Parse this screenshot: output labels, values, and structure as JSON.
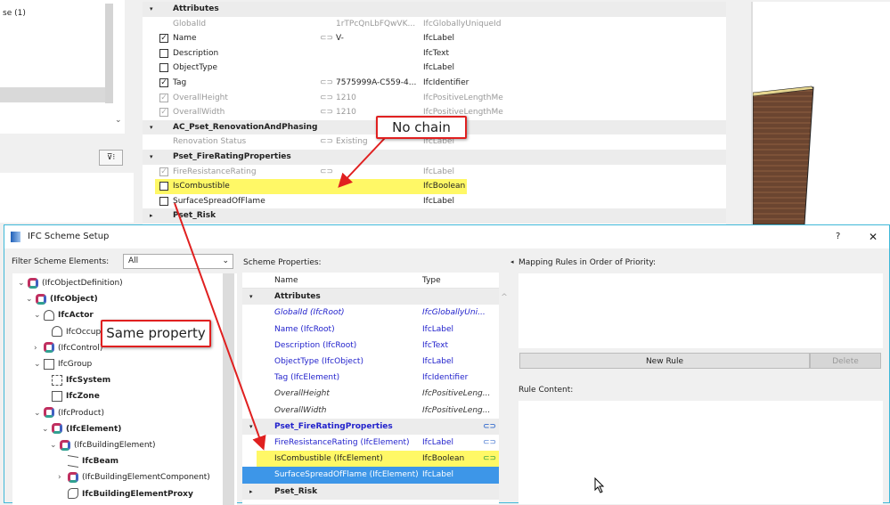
{
  "background": {
    "left_list_item": "se (1)",
    "props_header": "Attributes",
    "rows": [
      {
        "type": "header",
        "name": "Attributes"
      },
      {
        "name": "GlobalId",
        "value": "1rTPcQnLbFQwVK...",
        "ifc": "IfcGloballyUniqueId",
        "state": "none",
        "dim": true
      },
      {
        "name": "Name",
        "value": "V-",
        "ifc": "IfcLabel",
        "state": "checked",
        "chain": true
      },
      {
        "name": "Description",
        "value": "",
        "ifc": "IfcText",
        "state": "unchecked"
      },
      {
        "name": "ObjectType",
        "value": "",
        "ifc": "IfcLabel",
        "state": "unchecked"
      },
      {
        "name": "Tag",
        "value": "7575999A-C559-4...",
        "ifc": "IfcIdentifier",
        "state": "checked",
        "chain": true
      },
      {
        "name": "OverallHeight",
        "value": "1210",
        "ifc": "IfcPositiveLengthMe",
        "state": "checked",
        "dim": true,
        "chain": true
      },
      {
        "name": "OverallWidth",
        "value": "1210",
        "ifc": "IfcPositiveLengthMe",
        "state": "checked",
        "dim": true,
        "chain": true
      },
      {
        "type": "header",
        "name": "AC_Pset_RenovationAndPhasing"
      },
      {
        "name": "Renovation Status",
        "value": "Existing",
        "ifc": "IfcLabel",
        "state": "none",
        "dim": true,
        "chain": true
      },
      {
        "type": "header",
        "name": "Pset_FireRatingProperties"
      },
      {
        "name": "FireResistanceRating",
        "value": "",
        "ifc": "IfcLabel",
        "state": "checked",
        "dim": true,
        "chain": true
      },
      {
        "name": "IsCombustible",
        "value": "",
        "ifc": "IfcBoolean",
        "state": "unchecked",
        "highlight": true
      },
      {
        "name": "SurfaceSpreadOfFlame",
        "value": "",
        "ifc": "IfcLabel",
        "state": "unchecked"
      },
      {
        "type": "header",
        "name": "Pset_Risk",
        "collapsed": true
      }
    ]
  },
  "dialog": {
    "title": "IFC Scheme Setup",
    "help": "?",
    "close": "✕",
    "filter_label": "Filter Scheme Elements:",
    "filter_value": "All",
    "tree": [
      {
        "label": "(IfcObjectDefinition)",
        "level": 0,
        "exp": "open",
        "bold": false,
        "icon": "ifc-logo-icon"
      },
      {
        "label": "(IfcObject)",
        "level": 1,
        "exp": "open",
        "bold": true,
        "icon": "ifc-logo-icon"
      },
      {
        "label": "IfcActor",
        "level": 2,
        "exp": "open",
        "bold": true,
        "icon": "actor-icon"
      },
      {
        "label": "IfcOccupant",
        "level": 3,
        "exp": "",
        "bold": false,
        "icon": "actor-icon"
      },
      {
        "label": "(IfcControl)",
        "level": 2,
        "exp": "closed",
        "bold": false,
        "icon": "ifc-logo-icon"
      },
      {
        "label": "IfcGroup",
        "level": 2,
        "exp": "open",
        "bold": false,
        "icon": "group-icon"
      },
      {
        "label": "IfcSystem",
        "level": 3,
        "exp": "",
        "bold": true,
        "icon": "system-icon"
      },
      {
        "label": "IfcZone",
        "level": 3,
        "exp": "",
        "bold": true,
        "icon": "group-icon"
      },
      {
        "label": "(IfcProduct)",
        "level": 2,
        "exp": "open",
        "bold": false,
        "icon": "ifc-logo-icon"
      },
      {
        "label": "(IfcElement)",
        "level": 3,
        "exp": "open",
        "bold": true,
        "icon": "ifc-logo-icon"
      },
      {
        "label": "(IfcBuildingElement)",
        "level": 4,
        "exp": "open",
        "bold": false,
        "icon": "ifc-logo-icon"
      },
      {
        "label": "IfcBeam",
        "level": 5,
        "exp": "",
        "bold": true,
        "icon": "beam-icon"
      },
      {
        "label": "(IfcBuildingElementComponent)",
        "level": 5,
        "exp": "closed",
        "bold": false,
        "icon": "ifc-logo-icon"
      },
      {
        "label": "IfcBuildingElementProxy",
        "level": 5,
        "exp": "",
        "bold": true,
        "icon": "proxy-icon"
      }
    ],
    "scheme_label": "Scheme Properties:",
    "columns": {
      "name": "Name",
      "type": "Type"
    },
    "props": [
      {
        "kind": "header",
        "name": "Attributes"
      },
      {
        "name": "GlobalId (IfcRoot)",
        "type": "IfcGloballyUni...",
        "italic": true
      },
      {
        "name": "Name (IfcRoot)",
        "type": "IfcLabel"
      },
      {
        "name": "Description (IfcRoot)",
        "type": "IfcText"
      },
      {
        "name": "ObjectType (IfcObject)",
        "type": "IfcLabel"
      },
      {
        "name": "Tag (IfcElement)",
        "type": "IfcIdentifier"
      },
      {
        "name": "OverallHeight",
        "type": "IfcPositiveLeng...",
        "italic": true,
        "black": true
      },
      {
        "name": "OverallWidth",
        "type": "IfcPositiveLeng...",
        "italic": true,
        "black": true
      },
      {
        "kind": "header",
        "name": "Pset_FireRatingProperties",
        "link": true
      },
      {
        "name": "FireResistanceRating (IfcElement)",
        "type": "IfcLabel",
        "link": true
      },
      {
        "name": "IsCombustible (IfcElement)",
        "type": "IfcBoolean",
        "link": true,
        "highlight": true
      },
      {
        "name": "SurfaceSpreadOfFlame (IfcElement)",
        "type": "IfcLabel",
        "selected": true
      },
      {
        "kind": "header",
        "name": "Pset_Risk",
        "collapsed": true
      }
    ],
    "mapping_label": "Mapping Rules in Order of Priority:",
    "new_rule": "New Rule",
    "delete": "Delete",
    "rule_content_label": "Rule Content:"
  },
  "callouts": {
    "no_chain": "No chain",
    "same_property": "Same property"
  },
  "colors": {
    "highlight": "#fff866",
    "selected": "#3d96e8",
    "link_blue": "#2222cc",
    "annotation_red": "#e02020",
    "dialog_border": "#3fb8d8"
  }
}
